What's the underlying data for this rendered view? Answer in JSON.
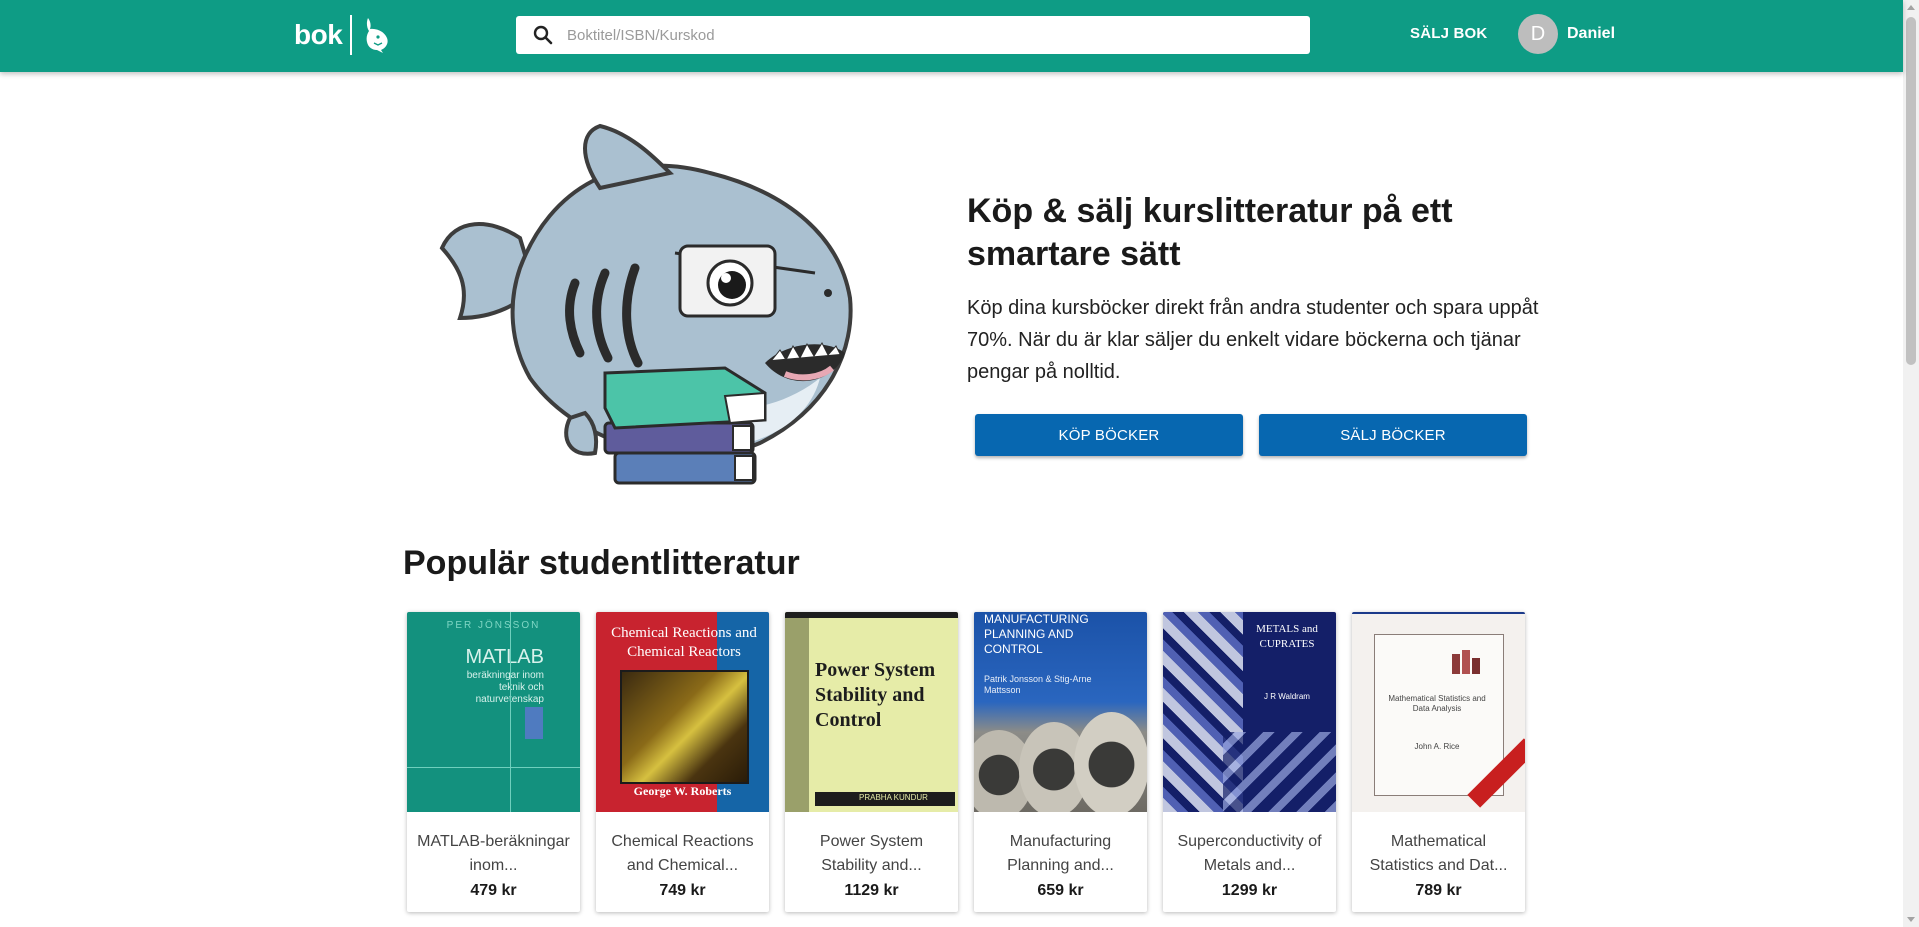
{
  "header": {
    "logo_text": "bok",
    "search_placeholder": "Boktitel/ISBN/Kurskod",
    "sell_link": "SÄLJ BOK",
    "user": {
      "initial": "D",
      "name": "Daniel"
    }
  },
  "hero": {
    "title": "Köp & sälj kurslitteratur på ett smartare sätt",
    "text": "Köp dina kursböcker direkt från andra studenter och spara uppåt 70%. När du är klar säljer du enkelt vidare böckerna och tjänar pengar på nolltid.",
    "buy_button": "KÖP BÖCKER",
    "sell_button": "SÄLJ BÖCKER"
  },
  "popular": {
    "heading": "Populär studentlitteratur",
    "books": [
      {
        "title": "MATLAB-beräkningar inom...",
        "price": "479 kr",
        "cover": {
          "author": "PER JÖNSSON",
          "title": "MATLAB",
          "subtitle": "beräkningar inom teknik och naturvetenskap"
        }
      },
      {
        "title": "Chemical Reactions and Chemical...",
        "price": "749 kr",
        "cover": {
          "title": "Chemical Reactions and Chemical Reactors",
          "author": "George W. Roberts"
        }
      },
      {
        "title": "Power System Stability and...",
        "price": "1129 kr",
        "cover": {
          "title": "Power System Stability and Control",
          "author": "PRABHA KUNDUR"
        }
      },
      {
        "title": "Manufacturing Planning and...",
        "price": "659 kr",
        "cover": {
          "title": "Manufacturing Planning and Control",
          "author": "Patrik Jonsson & Stig-Arne Mattsson"
        }
      },
      {
        "title": "Superconductivity of Metals and...",
        "price": "1299 kr",
        "cover": {
          "title": "METALS and CUPRATES",
          "author": "J R Waldram"
        }
      },
      {
        "title": "Mathematical Statistics and Dat...",
        "price": "789 kr",
        "cover": {
          "title": "Mathematical Statistics and Data Analysis",
          "author": "John A. Rice"
        }
      }
    ]
  }
}
